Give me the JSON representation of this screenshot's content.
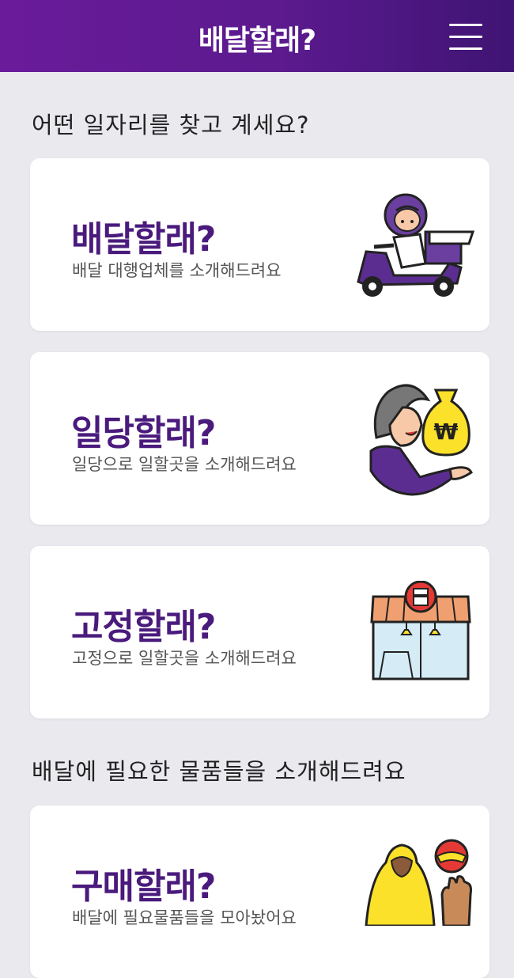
{
  "header": {
    "title": "배달할래?"
  },
  "section1": {
    "title": "어떤 일자리를 찾고 계세요?"
  },
  "cards": [
    {
      "title": "배달할래?",
      "desc": "배달 대행업체를 소개해드려요",
      "icon": "scooter-rider-icon"
    },
    {
      "title": "일당할래?",
      "desc": "일당으로 일할곳을 소개해드려요",
      "icon": "money-bag-icon"
    },
    {
      "title": "고정할래?",
      "desc": "고정으로 일할곳을 소개해드려요",
      "icon": "store-icon"
    }
  ],
  "section2": {
    "title": "배달에 필요한 물품들을 소개해드려요"
  },
  "shop_card": {
    "title": "구매할래?",
    "desc": "배달에 필요물품들을 모아놨어요",
    "icon": "raincoat-helmet-gloves-icon"
  },
  "colors": {
    "header_start": "#6a1b9a",
    "header_end": "#3f1473",
    "accent": "#4a1a7c",
    "background": "#e9e9ee"
  }
}
